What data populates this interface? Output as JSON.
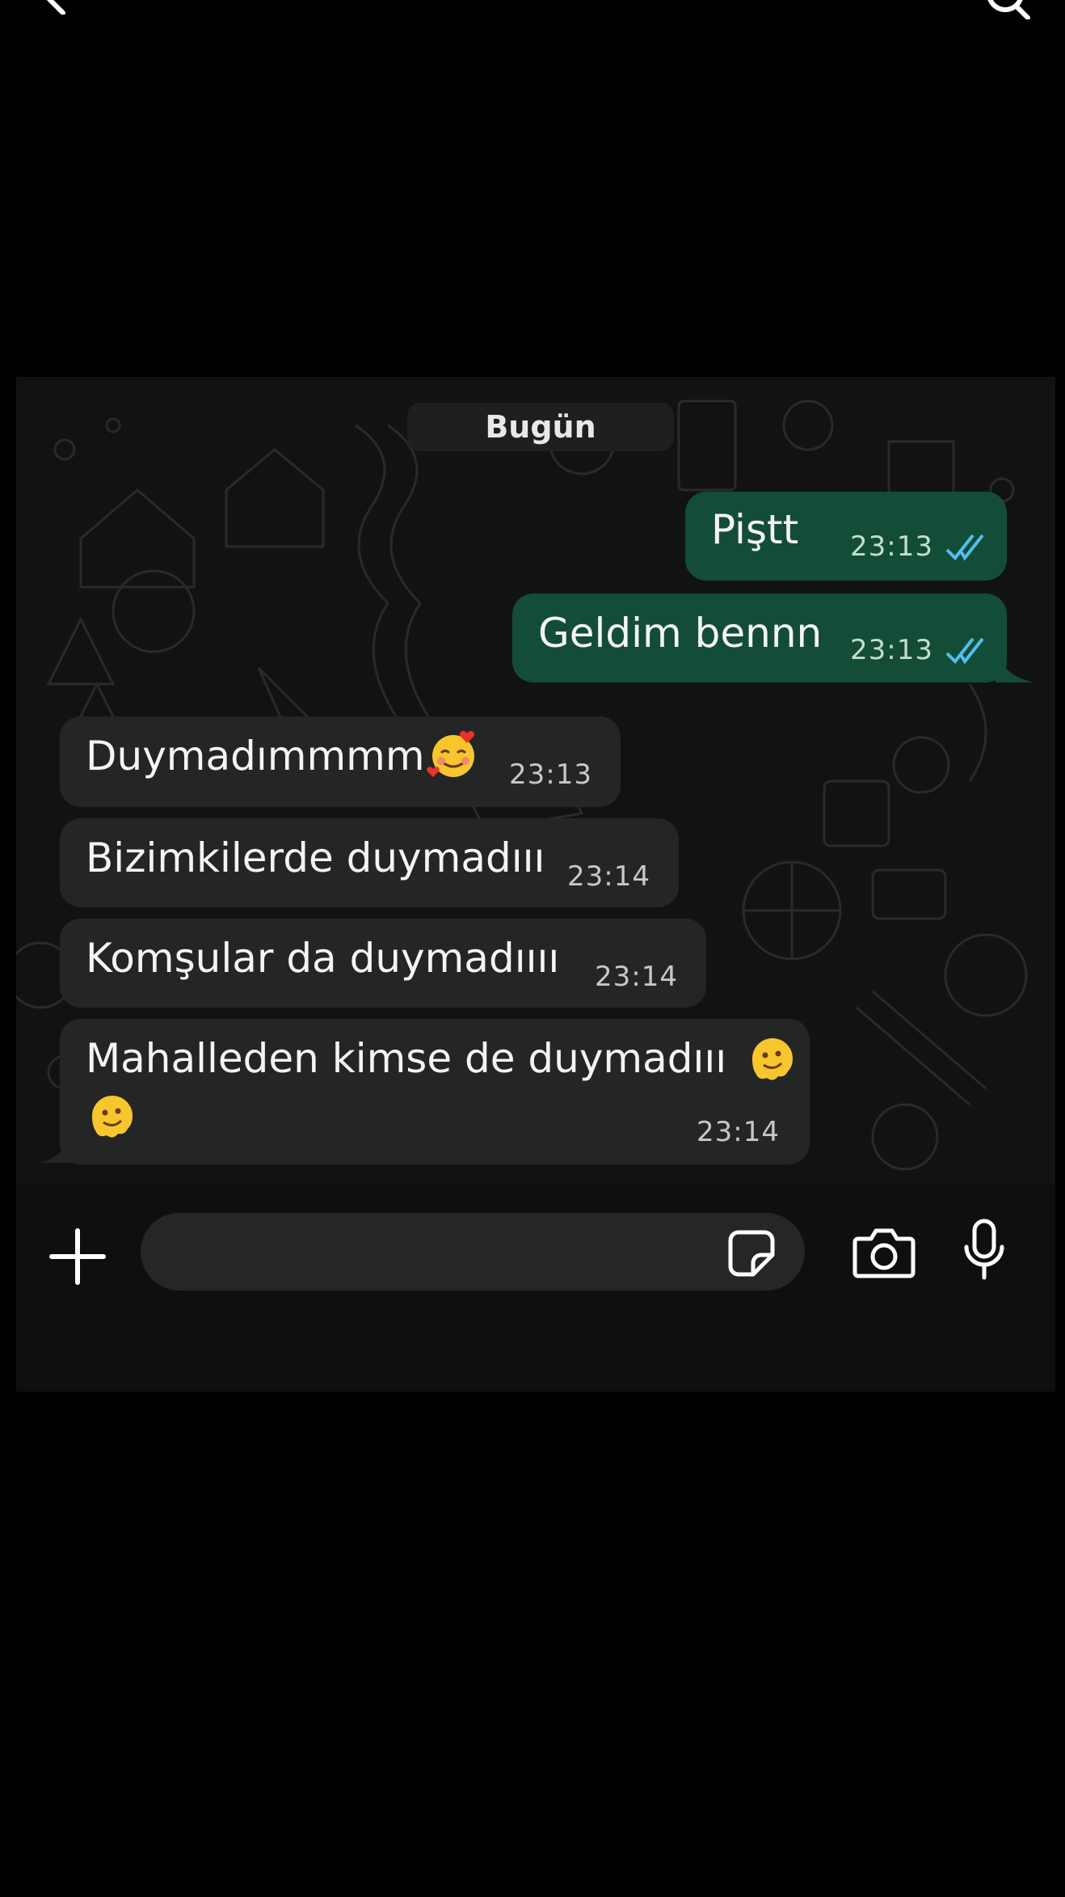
{
  "header": {
    "back_icon": "chevron-left-icon",
    "search_icon": "search-icon"
  },
  "chat": {
    "date_label": "Bugün",
    "messages": [
      {
        "direction": "outgoing",
        "text": "Piştt",
        "time": "23:13",
        "status": "read"
      },
      {
        "direction": "outgoing",
        "text": "Geldim bennn",
        "time": "23:13",
        "status": "read"
      },
      {
        "direction": "incoming",
        "text": "Duymadımmmm",
        "emoji": "smiling-face-with-hearts",
        "time": "23:13"
      },
      {
        "direction": "incoming",
        "text": "Bizimkilerde duymadııı",
        "time": "23:14"
      },
      {
        "direction": "incoming",
        "text": "Komşular da duymadıııı",
        "time": "23:14"
      },
      {
        "direction": "incoming",
        "text": "Mahalleden kimse de duymadııı",
        "emoji": "melting-face",
        "emoji_count": 2,
        "time": "23:14"
      }
    ]
  },
  "composer": {
    "placeholder": "",
    "icons": [
      "plus-icon",
      "sticker-icon",
      "camera-icon",
      "microphone-icon"
    ]
  },
  "colors": {
    "outgoing_bubble": "#134d37",
    "incoming_bubble": "#242626",
    "read_ticks": "#53bdeb",
    "background": "#000000"
  }
}
